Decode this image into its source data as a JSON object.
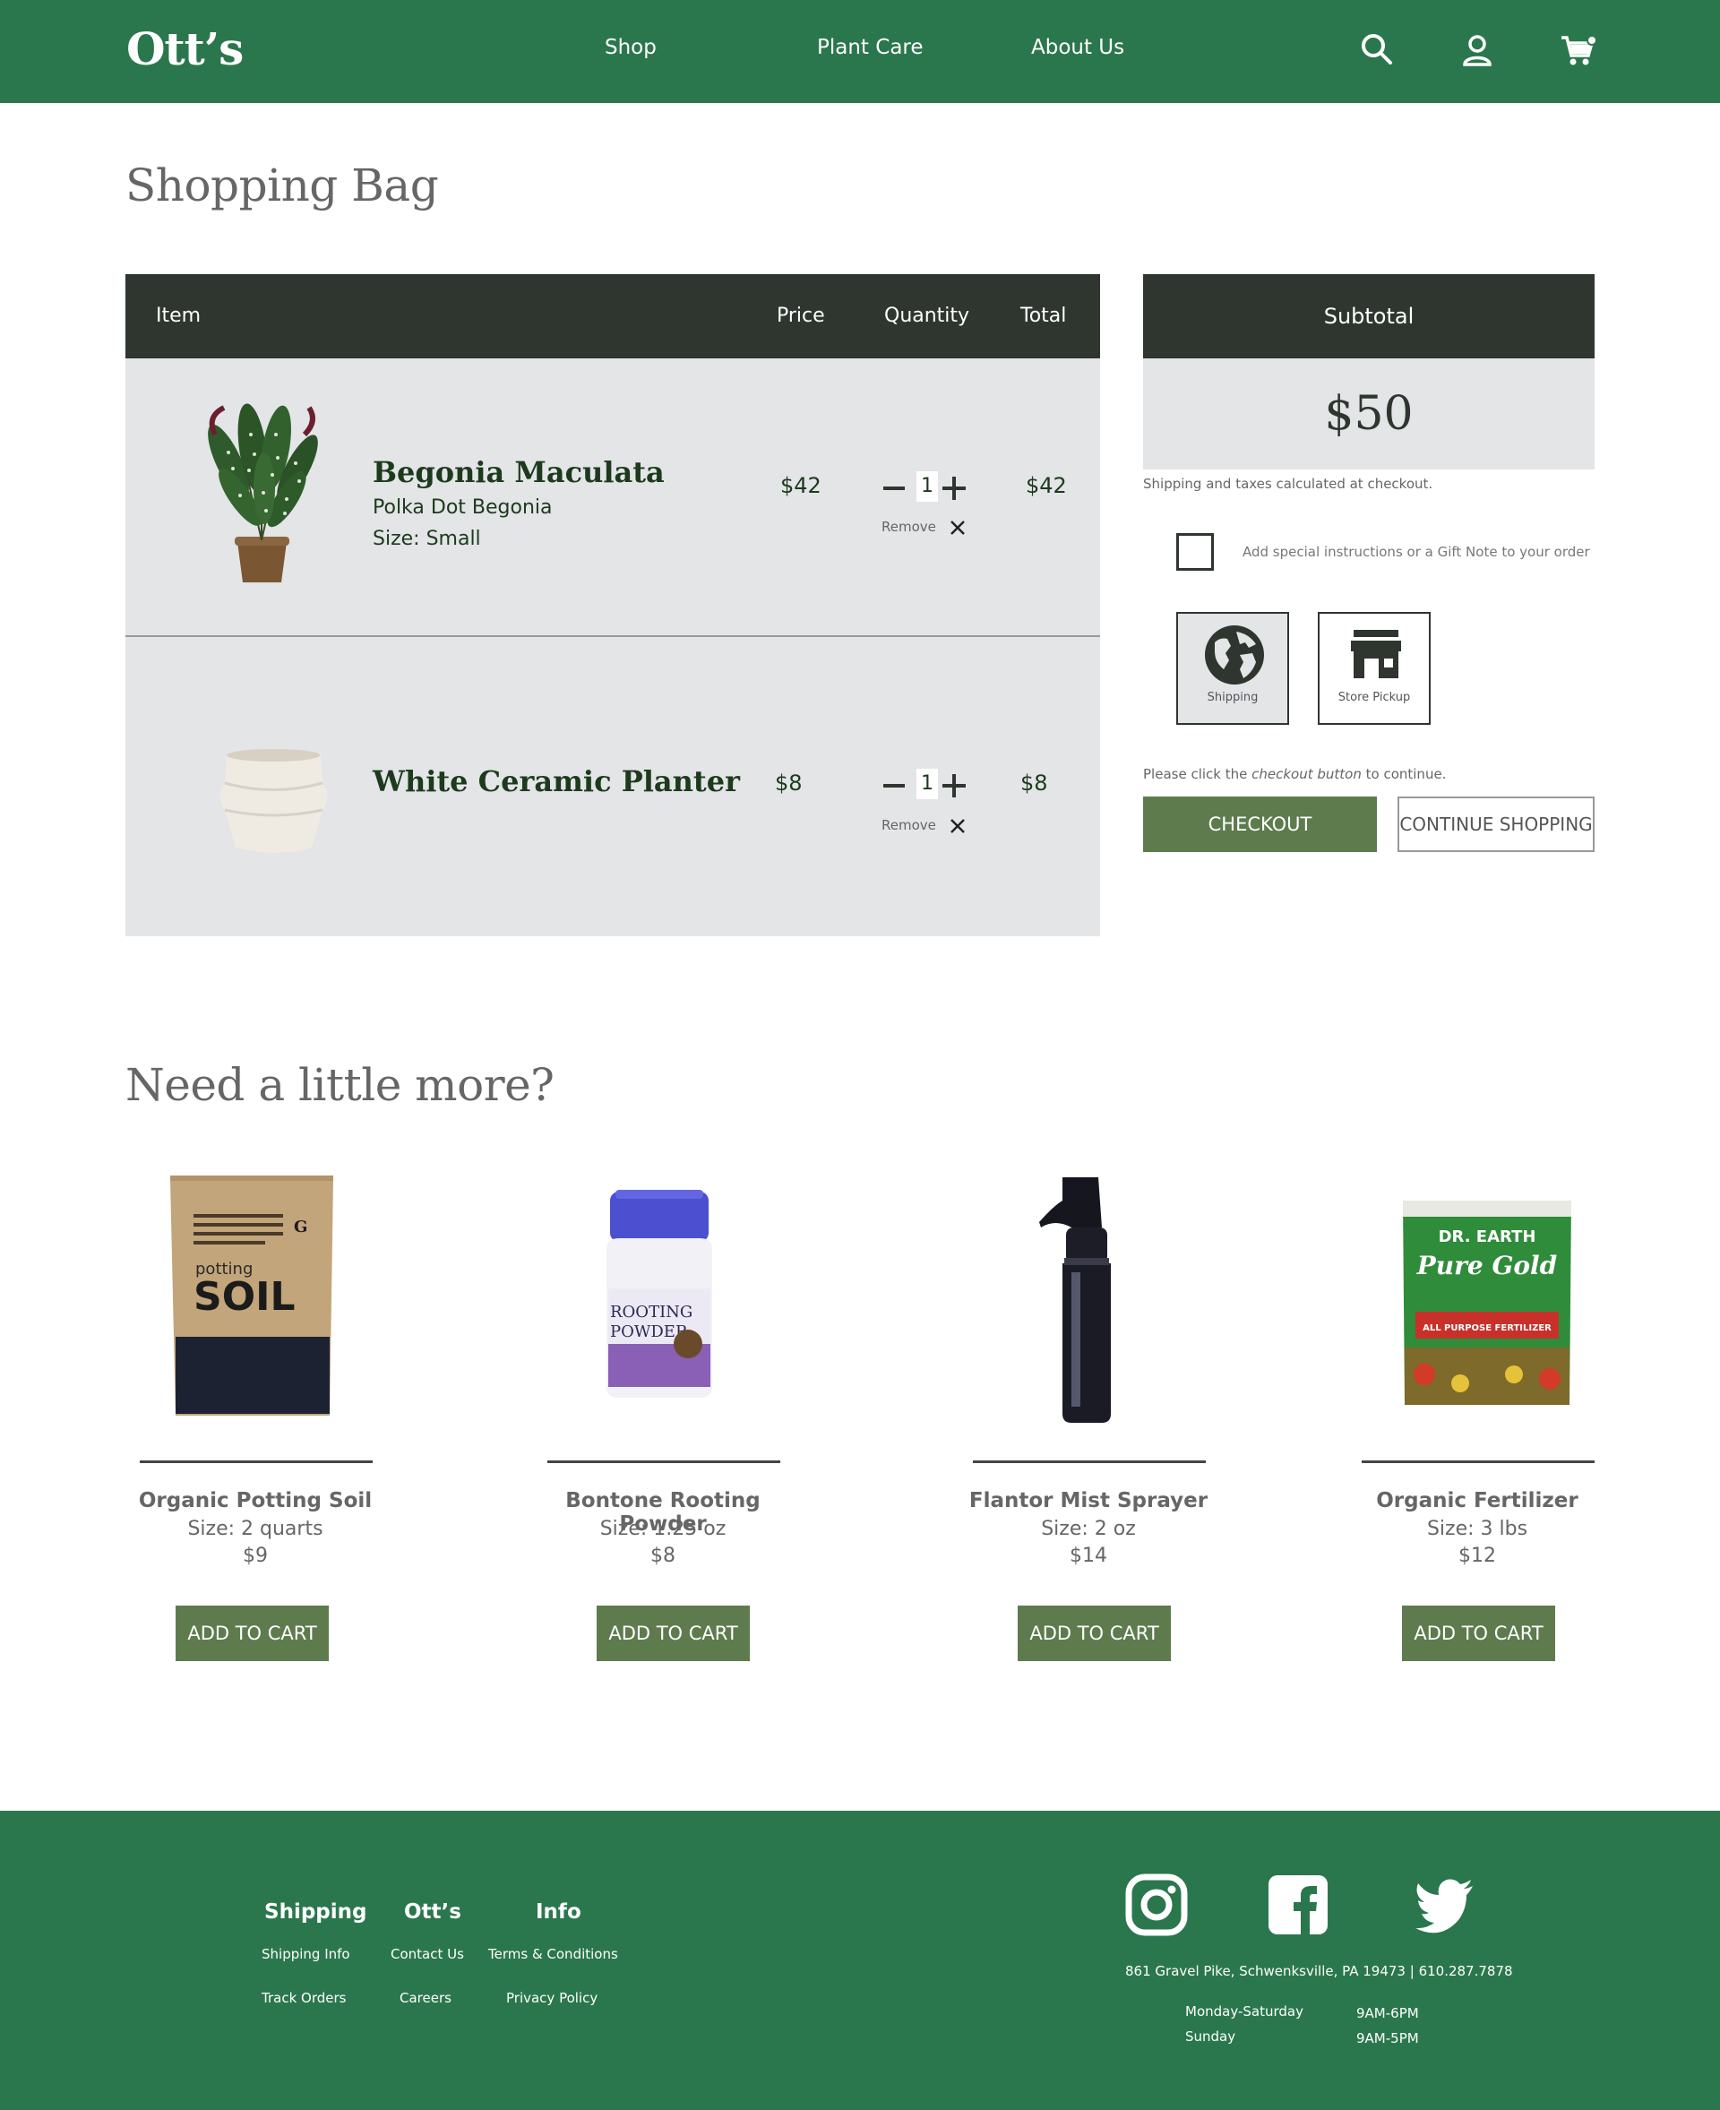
{
  "header": {
    "logo": "Ott’s",
    "nav": [
      "Shop",
      "Plant Care",
      "About Us"
    ],
    "icons": [
      "search-icon",
      "account-icon",
      "cart-icon"
    ]
  },
  "page_title": "Shopping Bag",
  "cart": {
    "columns": {
      "item": "Item",
      "price": "Price",
      "quantity": "Quantity",
      "total": "Total"
    },
    "items": [
      {
        "name": "Begonia Maculata",
        "subtitle": "Polka Dot Begonia",
        "size": "Size: Small",
        "price": "$42",
        "quantity": "1",
        "total": "$42",
        "remove": "Remove"
      },
      {
        "name": "White Ceramic Planter",
        "price": "$8",
        "quantity": "1",
        "total": "$8",
        "remove": "Remove"
      }
    ]
  },
  "summary": {
    "heading": "Subtotal",
    "amount": "$50",
    "shipping_note": "Shipping and taxes calculated at checkout.",
    "gift_label": "Add special instructions or a Gift Note to your order",
    "options": [
      {
        "label": "Shipping",
        "icon": "globe-icon",
        "selected": true
      },
      {
        "label": "Store Pickup",
        "icon": "store-icon",
        "selected": false
      }
    ],
    "note_pre": "Please click the ",
    "note_em": "checkout button",
    "note_post": " to continue.",
    "checkout": "CHECKOUT",
    "continue": "CONTINUE SHOPPING"
  },
  "recommendations": {
    "title": "Need a little more?",
    "items": [
      {
        "name": "Organic Potting Soil",
        "size": "Size: 2 quarts",
        "price": "$9",
        "button": "ADD TO CART",
        "bag_text_small": "potting",
        "bag_text_big": "SOIL"
      },
      {
        "name": "Bontone Rooting Powder",
        "size": "Size: 1.25 oz",
        "price": "$8",
        "button": "ADD TO CART",
        "label_text": "ROOTING POWDER"
      },
      {
        "name": "Flantor Mist Sprayer",
        "size": "Size: 2 oz",
        "price": "$14",
        "button": "ADD TO CART"
      },
      {
        "name": "Organic Fertilizer",
        "size": "Size: 3 lbs",
        "price": "$12",
        "button": "ADD TO CART",
        "label_top": "DR. EARTH",
        "label_mid": "Pure Gold",
        "label_bottom": "ALL PURPOSE FERTILIZER"
      }
    ]
  },
  "footer": {
    "columns": [
      {
        "heading": "Shipping",
        "links": [
          "Shipping Info",
          "Track Orders"
        ]
      },
      {
        "heading": "Ott’s",
        "links": [
          "Contact Us",
          "Careers"
        ]
      },
      {
        "heading": "Info",
        "links": [
          "Terms & Conditions",
          "Privacy Policy"
        ]
      }
    ],
    "social": [
      "instagram-icon",
      "facebook-icon",
      "twitter-icon"
    ],
    "address": "861 Gravel Pike, Schwenksville, PA 19473 | 610.287.7878",
    "hours": [
      {
        "days": "Monday-Saturday",
        "time": "9AM-6PM"
      },
      {
        "days": "Sunday",
        "time": "9AM-5PM"
      }
    ]
  },
  "colors": {
    "brand_green": "#2b774d",
    "dark": "#2e362f",
    "button_green": "#5e7b4e",
    "row_gray": "#e3e5e7"
  }
}
